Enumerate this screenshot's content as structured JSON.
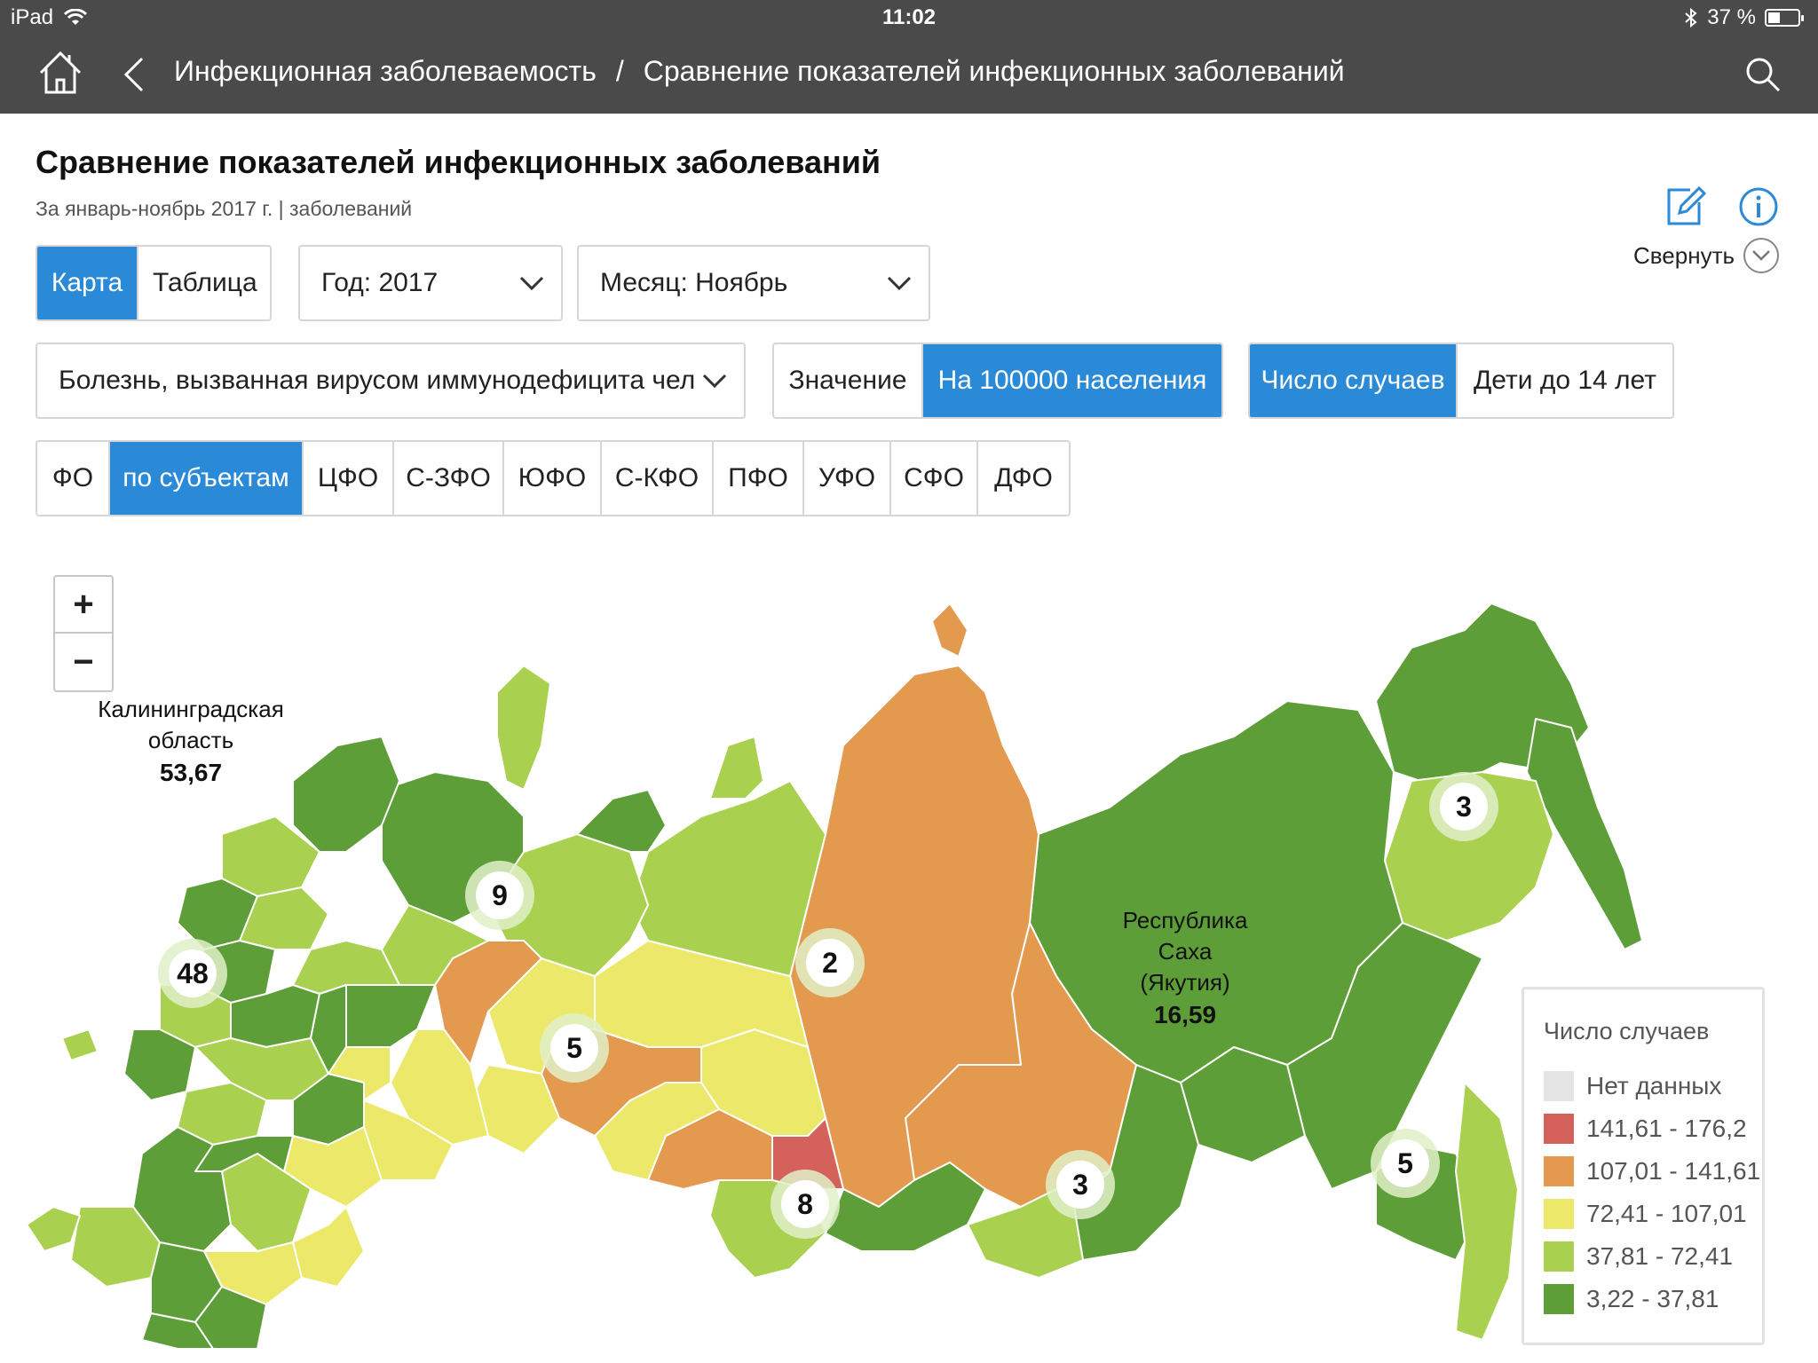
{
  "status": {
    "device": "iPad",
    "time": "11:02",
    "battery": "37 %"
  },
  "nav": {
    "breadcrumb_parent": "Инфекционная заболеваемость",
    "breadcrumb_sep": "/",
    "breadcrumb_current": "Сравнение показателей инфекционных заболеваний"
  },
  "header": {
    "title": "Сравнение показателей инфекционных заболеваний",
    "subtitle": "За январь-ноябрь 2017 г. | заболеваний",
    "collapse_label": "Свернуть"
  },
  "view_toggle": {
    "map": "Карта",
    "table": "Таблица",
    "active": "map"
  },
  "year_select": {
    "value": "Год: 2017"
  },
  "month_select": {
    "value": "Месяц: Ноябрь"
  },
  "disease_select": {
    "value": "Болезнь, вызванная вирусом иммунодефицита чел"
  },
  "measure_toggle": {
    "value": "Значение",
    "per100k": "На 100000 населения",
    "active": "per100k"
  },
  "cases_toggle": {
    "cases": "Число случаев",
    "children": "Дети до 14 лет",
    "active": "cases"
  },
  "district_tabs": {
    "items": [
      "ФО",
      "по субъектам",
      "ЦФО",
      "С-ЗФО",
      "ЮФО",
      "С-КФО",
      "ПФО",
      "УФО",
      "СФО",
      "ДФО"
    ],
    "active_index": 1
  },
  "map": {
    "zoom_in": "+",
    "zoom_out": "−",
    "labels": {
      "kaliningrad_name": "Калининградская область",
      "kaliningrad_value": "53,67",
      "yakutia_name": "Республика Саха (Якутия)",
      "yakutia_value": "16,59"
    },
    "clusters": [
      {
        "id": "nw",
        "count": "9"
      },
      {
        "id": "west",
        "count": "48"
      },
      {
        "id": "volga",
        "count": "5"
      },
      {
        "id": "ural",
        "count": "2"
      },
      {
        "id": "siberia-south",
        "count": "8"
      },
      {
        "id": "baikal",
        "count": "3"
      },
      {
        "id": "magadan",
        "count": "3"
      },
      {
        "id": "far-east",
        "count": "5"
      }
    ]
  },
  "legend": {
    "title": "Число случаев",
    "items": [
      {
        "label": "Нет данных",
        "color": "#e4e4e4"
      },
      {
        "label": "141,61 - 176,2",
        "color": "#d4625a"
      },
      {
        "label": "107,01 - 141,61",
        "color": "#e49a4e"
      },
      {
        "label": "72,41 - 107,01",
        "color": "#ece86a"
      },
      {
        "label": "37,81 - 72,41",
        "color": "#a9d04f"
      },
      {
        "label": "3,22 - 37,81",
        "color": "#5e9e38"
      }
    ]
  },
  "colors": {
    "accent": "#2a8ad8",
    "bar": "#4a4a4a",
    "dark_green": "#5e9e38",
    "light_green": "#a9d04f",
    "yellow": "#ece86a",
    "orange": "#e49a4e",
    "red": "#d4625a"
  }
}
